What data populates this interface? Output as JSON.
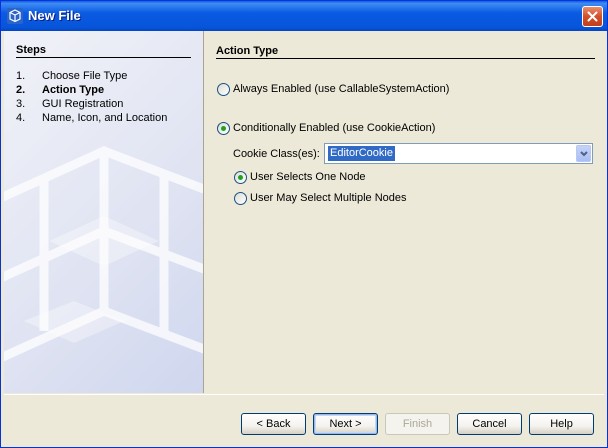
{
  "window": {
    "title": "New File",
    "icon": "netbeans-cube-icon"
  },
  "steps": {
    "title": "Steps",
    "items": [
      {
        "num": "1.",
        "label": "Choose File Type",
        "current": false
      },
      {
        "num": "2.",
        "label": "Action Type",
        "current": true
      },
      {
        "num": "3.",
        "label": "GUI Registration",
        "current": false
      },
      {
        "num": "4.",
        "label": "Name, Icon, and Location",
        "current": false
      }
    ]
  },
  "action": {
    "title": "Action Type",
    "always_enabled": {
      "label": "Always Enabled (use CallableSystemAction)",
      "selected": false
    },
    "conditionally_enabled": {
      "label": "Conditionally Enabled (use CookieAction)",
      "selected": true
    },
    "cookie_label": "Cookie Class(es):",
    "cookie_value": "EditorCookie",
    "one_node": {
      "label": "User Selects One Node",
      "selected": true
    },
    "multiple_nodes": {
      "label": "User May Select Multiple Nodes",
      "selected": false
    }
  },
  "buttons": {
    "back": "< Back",
    "next": "Next >",
    "finish": "Finish",
    "cancel": "Cancel",
    "help": "Help"
  },
  "colors": {
    "title_bar": "#0755d9",
    "close_button": "#d2502b",
    "selection": "#316ac5",
    "radio_dot": "#21a121"
  }
}
